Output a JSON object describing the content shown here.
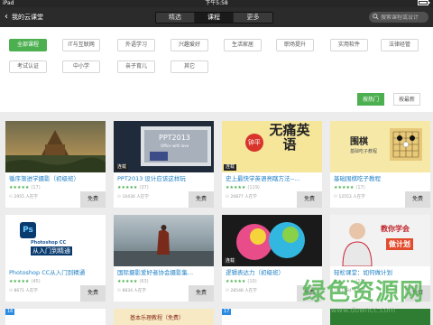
{
  "status_bar": {
    "device": "iPad",
    "time": "下午5:58",
    "battery": ""
  },
  "nav": {
    "back_label": "我的云课堂",
    "segments": [
      {
        "label": "精选",
        "active": false
      },
      {
        "label": "课程",
        "active": true
      },
      {
        "label": "更多",
        "active": false
      }
    ],
    "search_placeholder": "搜索课程或设计"
  },
  "filters": {
    "row1": [
      {
        "label": "全部课程",
        "active": true
      },
      {
        "label": "IT与互联网",
        "active": false
      },
      {
        "label": "外语学习",
        "active": false
      },
      {
        "label": "兴趣爱好",
        "active": false
      },
      {
        "label": "生活家居",
        "active": false
      },
      {
        "label": "职场提升",
        "active": false
      },
      {
        "label": "实用软件",
        "active": false
      },
      {
        "label": "法律经管",
        "active": false
      }
    ],
    "row2": [
      {
        "label": "考试认证",
        "active": false
      },
      {
        "label": "中小学",
        "active": false
      },
      {
        "label": "亲子育儿",
        "active": false
      },
      {
        "label": "其它",
        "active": false
      }
    ]
  },
  "sort": [
    {
      "label": "按热门",
      "active": true
    },
    {
      "label": "按最新",
      "active": false
    }
  ],
  "courses": [
    {
      "title": "循序渐进学摄影（初级班）",
      "rating_count": "(17)",
      "learners": "2955 人在学",
      "price": "免费",
      "badge": ""
    },
    {
      "title": "PPT2013 设计应该这样玩",
      "rating_count": "(37)",
      "learners": "10430 人在学",
      "price": "免费",
      "badge": "连载"
    },
    {
      "title": "史上最快学英语亮瞎方法--...",
      "rating_count": "(119)",
      "learners": "20877 人在学",
      "price": "免费",
      "badge": "连载"
    },
    {
      "title": "基础围棋吃子教程",
      "rating_count": "(17)",
      "learners": "12553 人在学",
      "price": "免费",
      "badge": ""
    },
    {
      "title": "Photoshop CC从入门到精通",
      "rating_count": "(45)",
      "learners": "8671 人在学",
      "price": "免费",
      "badge": ""
    },
    {
      "title": "国际摄影爱好者协会摄影集...",
      "rating_count": "(63)",
      "learners": "8834 人在学",
      "price": "免费",
      "badge": ""
    },
    {
      "title": "逻辑表达力（初级班）",
      "rating_count": "(10)",
      "learners": "28548 人在学",
      "price": "免费",
      "badge": "连载"
    },
    {
      "title": "轻松课堂：如何做计划",
      "rating_count": "(13)",
      "learners": "11584 人在学",
      "price": "免费",
      "badge": ""
    }
  ],
  "thumb_text": {
    "ppt_title": "PPT2013",
    "ppt_sub": "Office with love",
    "eng_big": "无痛英语",
    "eng_seal": "钟平",
    "go_title": "围棋",
    "go_sub": "基础吃子教程",
    "ps_title": "Photoshop CC",
    "ps_sub": "从入门到精通",
    "plan_line1": "教你学会",
    "plan_line2": "做计划",
    "next_row_title": "基本乐理教程（免费）",
    "next_row_num": "17"
  },
  "watermark": {
    "title": "绿色资源网",
    "url": "www.downcc.com"
  }
}
